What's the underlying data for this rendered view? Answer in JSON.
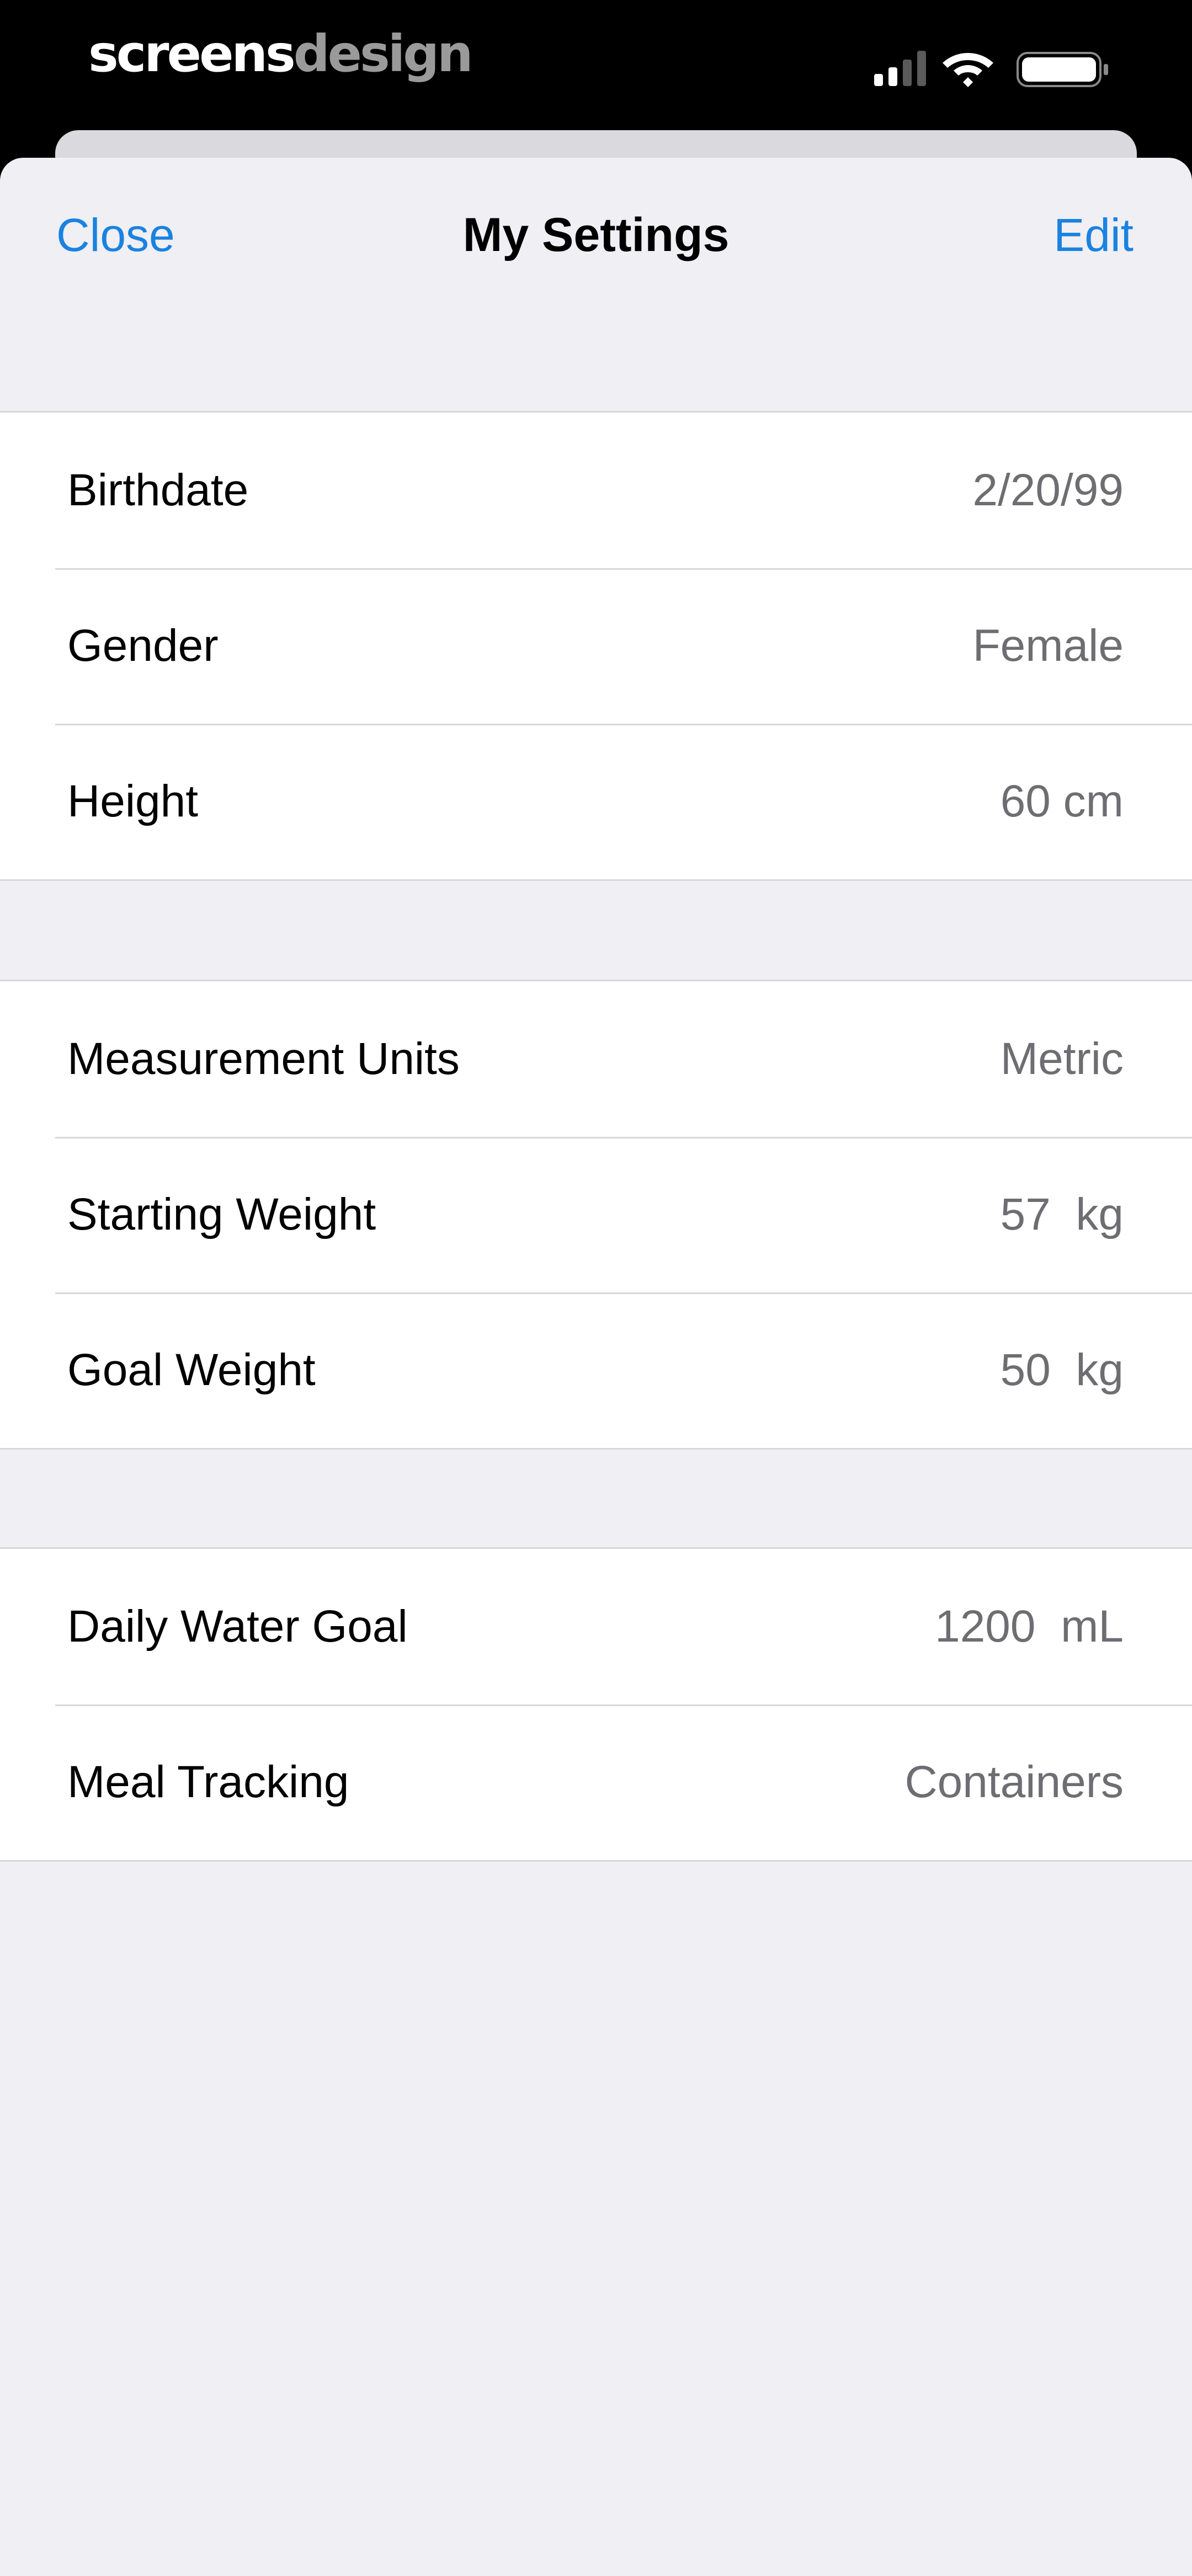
{
  "status_bar": {
    "brand_part1": "screens",
    "brand_part2": "design",
    "signal_icon": "cellular-signal-icon",
    "wifi_icon": "wifi-icon",
    "battery_icon": "battery-icon"
  },
  "nav": {
    "close_label": "Close",
    "title": "My Settings",
    "edit_label": "Edit"
  },
  "groups": [
    {
      "rows": [
        {
          "label": "Birthdate",
          "value": "2/20/99"
        },
        {
          "label": "Gender",
          "value": "Female"
        },
        {
          "label": "Height",
          "value": "60 cm"
        }
      ]
    },
    {
      "rows": [
        {
          "label": "Measurement Units",
          "value": "Metric"
        },
        {
          "label": "Starting Weight",
          "value": "57  kg"
        },
        {
          "label": "Goal Weight",
          "value": "50  kg"
        }
      ]
    },
    {
      "rows": [
        {
          "label": "Daily Water Goal",
          "value": "1200  mL"
        },
        {
          "label": "Meal Tracking",
          "value": "Containers"
        }
      ]
    }
  ],
  "colors": {
    "accent": "#1a82e0",
    "background": "#efeff4",
    "value_text": "#6d6d72"
  }
}
